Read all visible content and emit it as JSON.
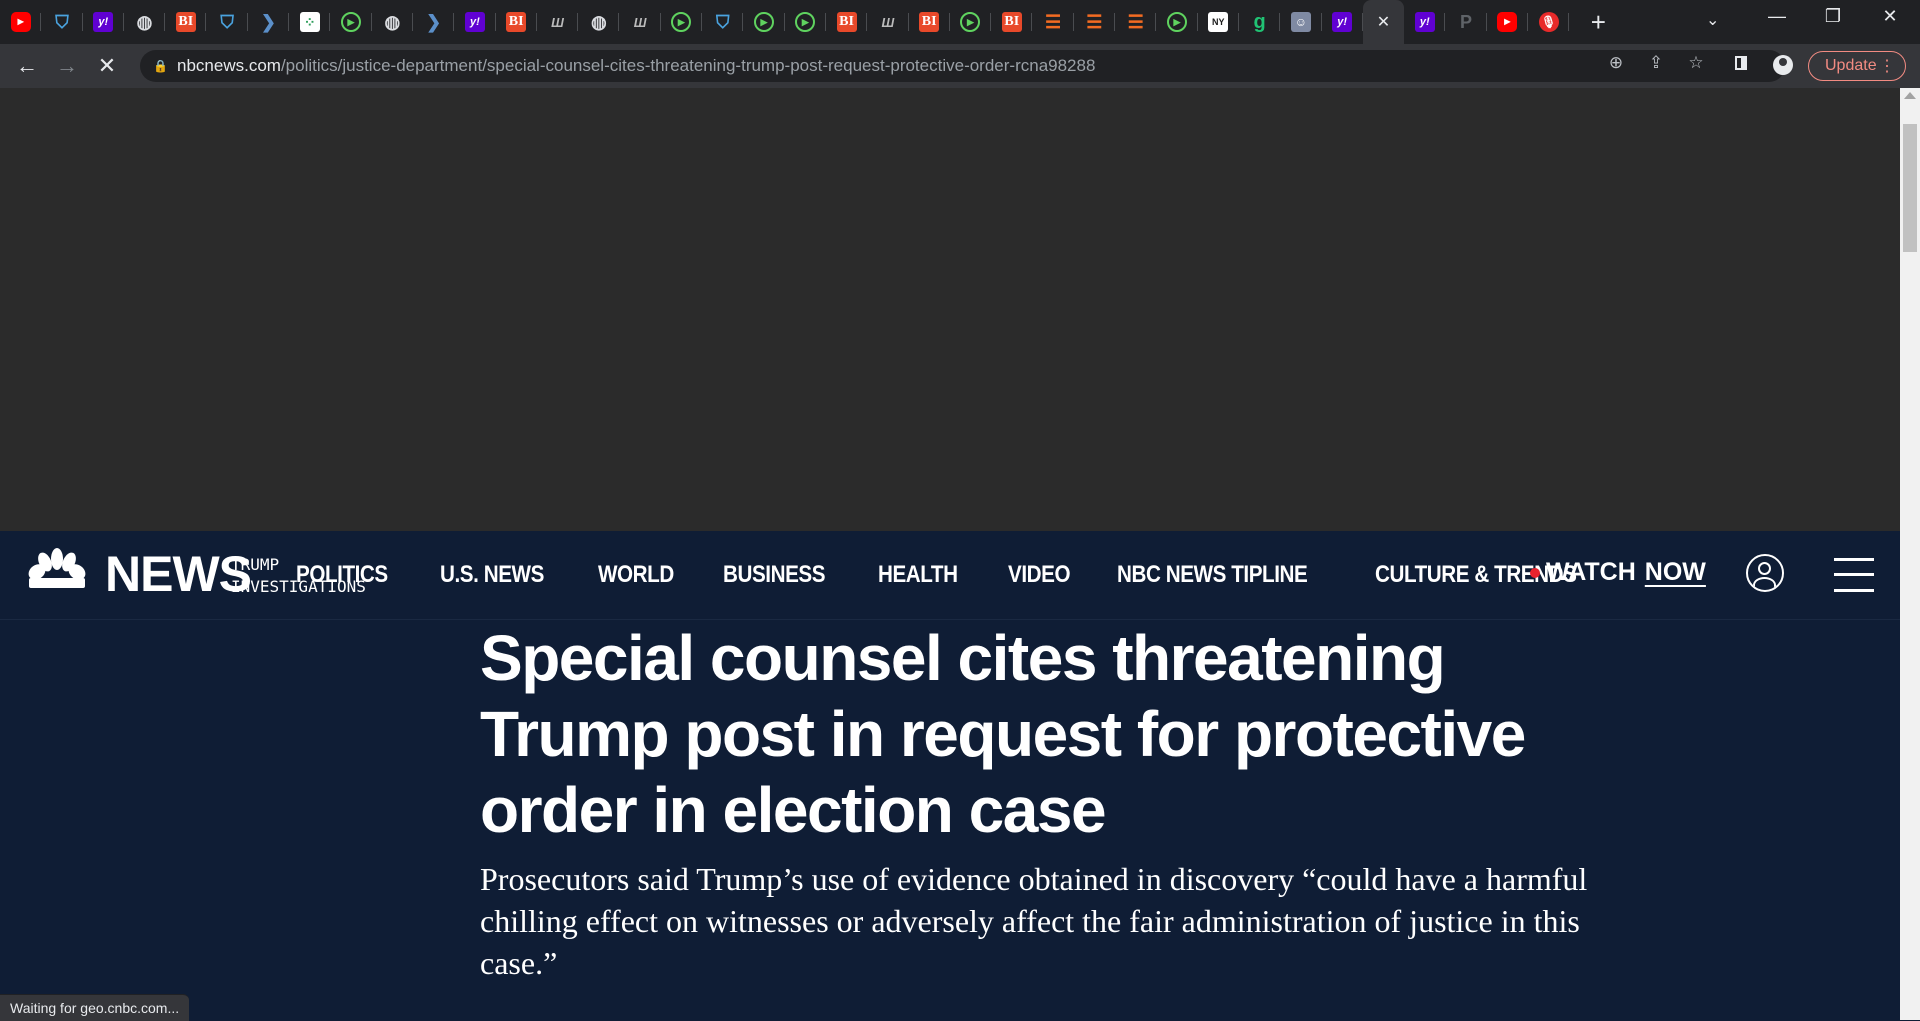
{
  "browser": {
    "tabs": [
      {
        "icon": "youtube-icon",
        "glyph": "▶",
        "style": "yt"
      },
      {
        "icon": "shield-icon",
        "glyph": "⛉",
        "style": "shield"
      },
      {
        "icon": "yahoo-icon",
        "glyph": "y!",
        "style": "yahoo"
      },
      {
        "icon": "globe-icon",
        "glyph": "◍",
        "style": "globe"
      },
      {
        "icon": "business-insider-icon",
        "glyph": "BI",
        "style": "bi"
      },
      {
        "icon": "shield-icon",
        "glyph": "⛉",
        "style": "shield"
      },
      {
        "icon": "arrow-icon",
        "glyph": "❯",
        "style": "arrow"
      },
      {
        "icon": "dots-icon",
        "glyph": "⁘",
        "style": "dots"
      },
      {
        "icon": "play-circle-icon",
        "glyph": "▶",
        "style": "play"
      },
      {
        "icon": "globe-icon",
        "glyph": "◍",
        "style": "globe"
      },
      {
        "icon": "arrow-icon",
        "glyph": "❯",
        "style": "arrow"
      },
      {
        "icon": "yahoo-icon",
        "glyph": "y!",
        "style": "yahoo"
      },
      {
        "icon": "business-insider-icon",
        "glyph": "BI",
        "style": "bi"
      },
      {
        "icon": "marketwatch-icon",
        "glyph": "Ш",
        "style": "mw"
      },
      {
        "icon": "globe-icon",
        "glyph": "◍",
        "style": "globe"
      },
      {
        "icon": "marketwatch-icon",
        "glyph": "Ш",
        "style": "mw"
      },
      {
        "icon": "play-circle-icon",
        "glyph": "▶",
        "style": "play"
      },
      {
        "icon": "shield-icon",
        "glyph": "⛉",
        "style": "shield"
      },
      {
        "icon": "play-circle-icon",
        "glyph": "▶",
        "style": "play"
      },
      {
        "icon": "play-circle-icon",
        "glyph": "▶",
        "style": "play"
      },
      {
        "icon": "business-insider-icon",
        "glyph": "BI",
        "style": "bi"
      },
      {
        "icon": "marketwatch-icon",
        "glyph": "Ш",
        "style": "mw"
      },
      {
        "icon": "business-insider-icon",
        "glyph": "BI",
        "style": "bi"
      },
      {
        "icon": "play-circle-icon",
        "glyph": "▶",
        "style": "play"
      },
      {
        "icon": "business-insider-icon",
        "glyph": "BI",
        "style": "bi"
      },
      {
        "icon": "bookmark-icon",
        "glyph": "☰",
        "style": "book"
      },
      {
        "icon": "bookmark-icon",
        "glyph": "☰",
        "style": "book"
      },
      {
        "icon": "bookmark-icon",
        "glyph": "☰",
        "style": "book"
      },
      {
        "icon": "play-circle-icon",
        "glyph": "▶",
        "style": "play"
      },
      {
        "icon": "newspaper-icon",
        "glyph": "NY",
        "style": "np"
      },
      {
        "icon": "g-icon",
        "glyph": "g",
        "style": "g"
      },
      {
        "icon": "photo-icon",
        "glyph": "☺",
        "style": "photo"
      },
      {
        "icon": "yahoo-icon",
        "glyph": "y!",
        "style": "yahoo"
      },
      {
        "icon": "close-icon",
        "glyph": "✕",
        "style": "close",
        "active": true
      },
      {
        "icon": "yahoo-icon",
        "glyph": "y!",
        "style": "yahoo"
      },
      {
        "icon": "p-icon",
        "glyph": "P",
        "style": "p"
      },
      {
        "icon": "youtube-icon",
        "glyph": "▶",
        "style": "yt"
      },
      {
        "icon": "microphone-icon",
        "glyph": "🎙",
        "style": "mic"
      }
    ],
    "new_tab": "+",
    "url_host": "nbcnews.com",
    "url_path": "/politics/justice-department/special-counsel-cites-threatening-trump-post-request-protective-order-rcna98288",
    "update_label": "Update",
    "status_text": "Waiting for geo.cnbc.com..."
  },
  "site": {
    "brand": "NEWS",
    "nav": [
      "POLITICS",
      "U.S. NEWS",
      "WORLD",
      "BUSINESS",
      "HEALTH",
      "VIDEO",
      "NBC NEWS TIPLINE",
      "CULTURE & TRENDS"
    ],
    "watch_label": "WATCH",
    "watch_now": "NOW"
  },
  "article": {
    "section": "TRUMP INVESTIGATIONS",
    "headline": "Special counsel cites threatening Trump post in request for protective order in election case",
    "dek": "Prosecutors said Trump’s use of evidence obtained in discovery “could have a harmful chilling effect on witnesses or adversely affect the fair administration of justice in this case.”"
  },
  "colors": {
    "page_bg": "#0f1d35",
    "ad_bg": "#2b2b2b",
    "live_dot": "#e8222d",
    "update_accent": "#f28b82"
  }
}
